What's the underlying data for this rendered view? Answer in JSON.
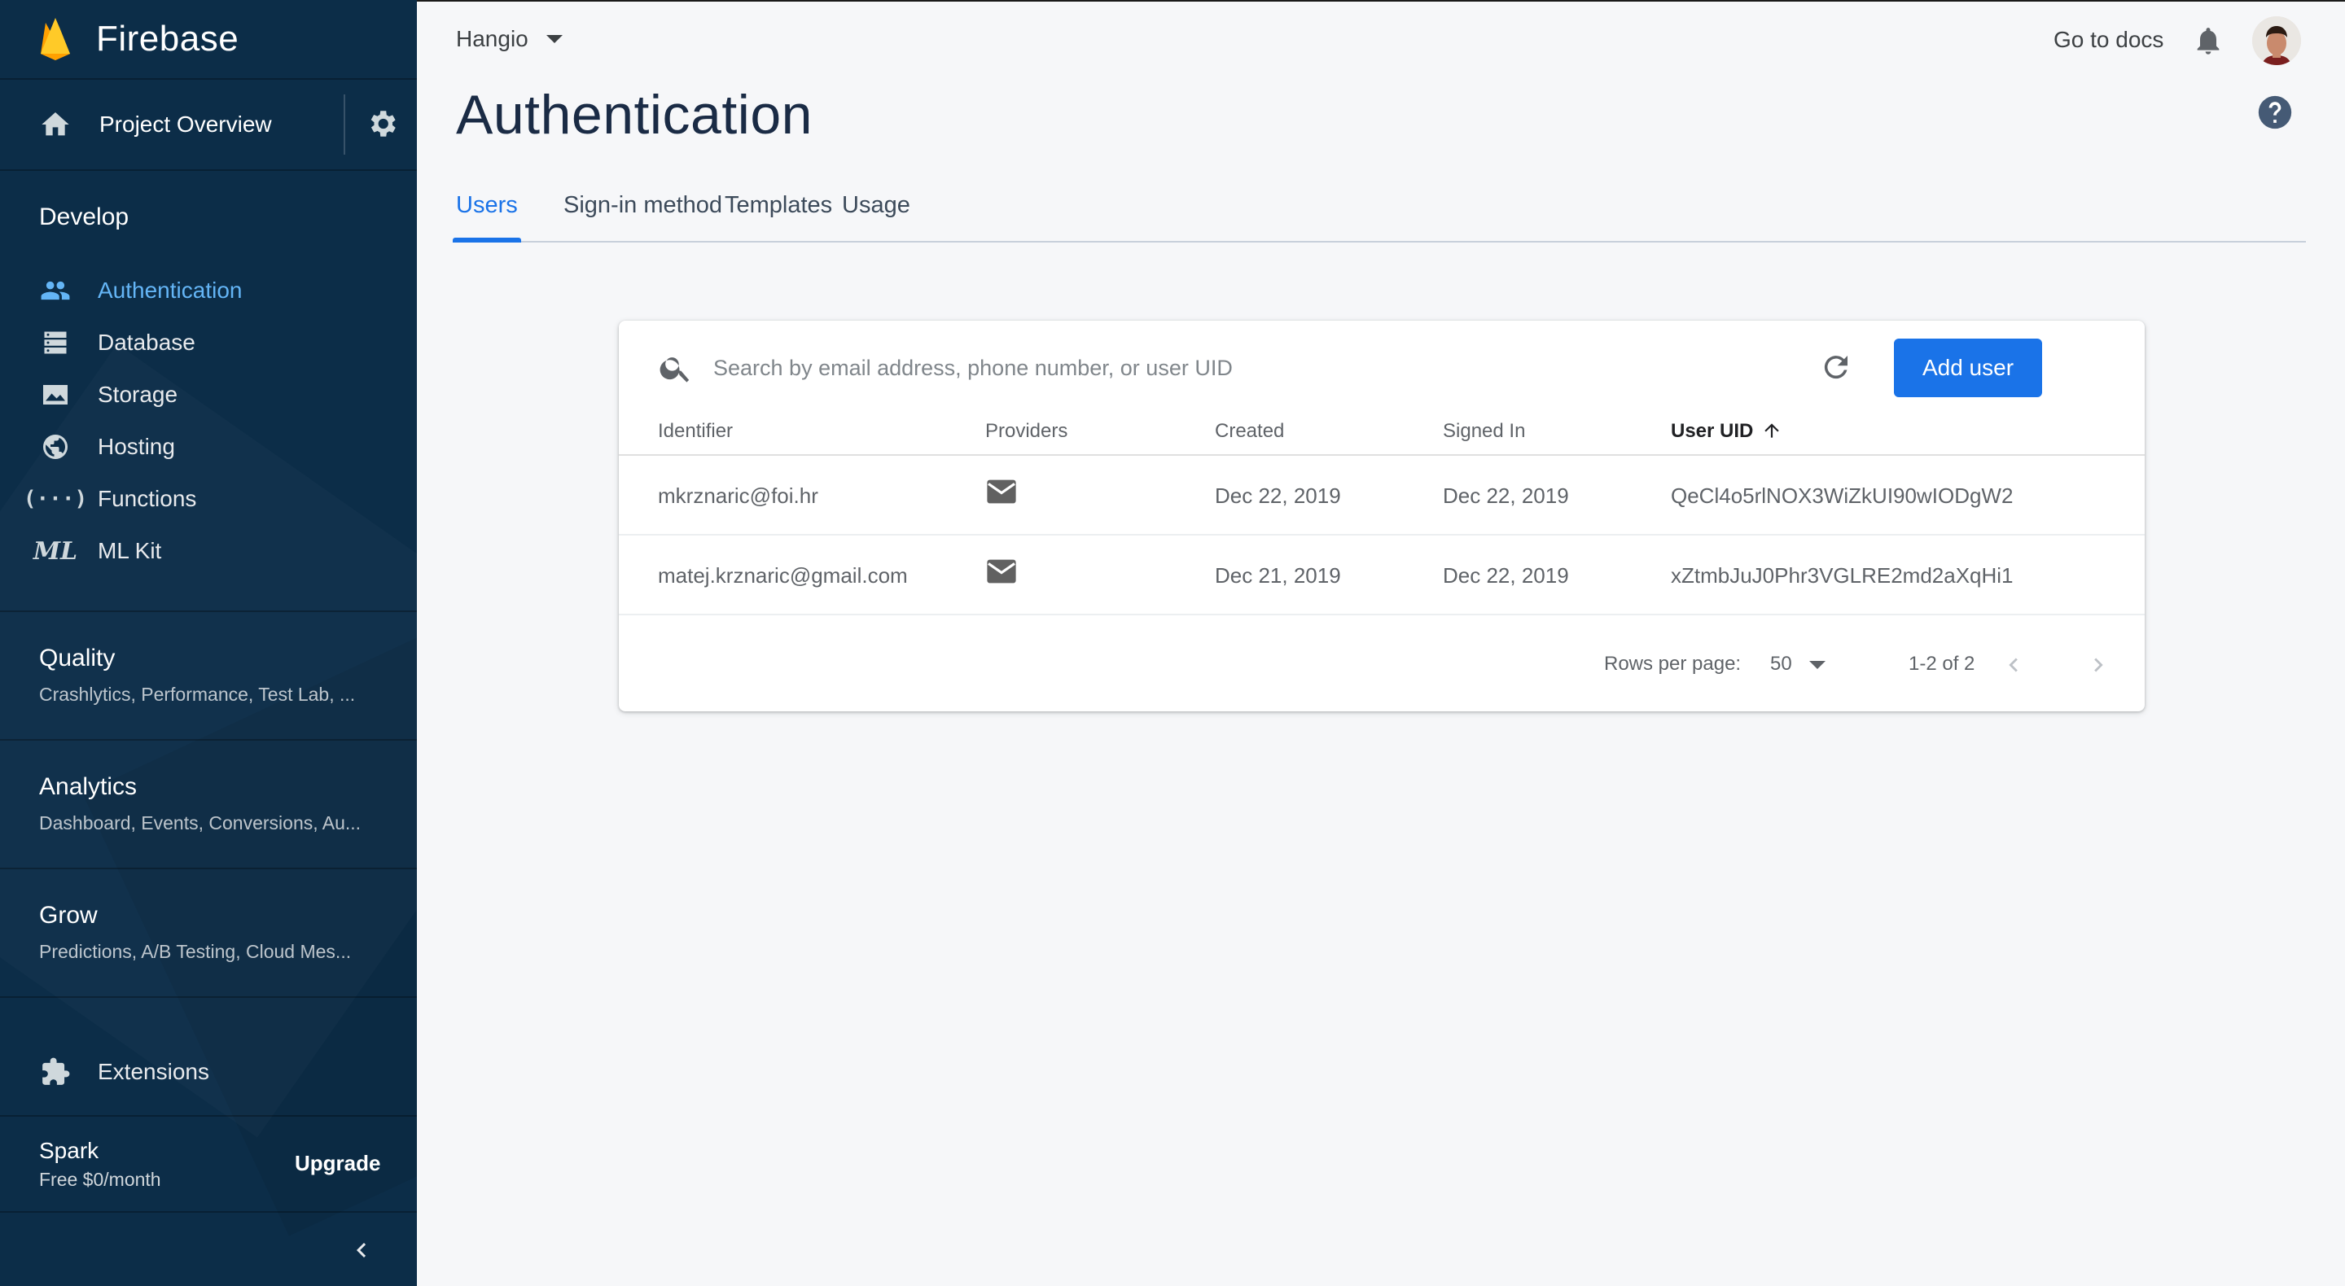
{
  "brand": {
    "name": "Firebase"
  },
  "overview": {
    "label": "Project Overview"
  },
  "develop": {
    "title": "Develop",
    "items": [
      {
        "label": "Authentication",
        "icon": "people-icon",
        "active": true
      },
      {
        "label": "Database",
        "icon": "database-icon",
        "active": false
      },
      {
        "label": "Storage",
        "icon": "storage-icon",
        "active": false
      },
      {
        "label": "Hosting",
        "icon": "globe-icon",
        "active": false
      },
      {
        "label": "Functions",
        "icon": "functions-icon",
        "active": false
      },
      {
        "label": "ML Kit",
        "icon": "mlkit-icon",
        "active": false
      }
    ]
  },
  "categories": [
    {
      "title": "Quality",
      "subtitle": "Crashlytics, Performance, Test Lab, ..."
    },
    {
      "title": "Analytics",
      "subtitle": "Dashboard, Events, Conversions, Au..."
    },
    {
      "title": "Grow",
      "subtitle": "Predictions, A/B Testing, Cloud Mes..."
    }
  ],
  "extensions": {
    "label": "Extensions"
  },
  "plan": {
    "name": "Spark",
    "price": "Free $0/month",
    "upgrade": "Upgrade"
  },
  "header": {
    "project": "Hangio",
    "docs": "Go to docs"
  },
  "page": {
    "title": "Authentication"
  },
  "tabs": [
    {
      "label": "Users",
      "active": true
    },
    {
      "label": "Sign-in method",
      "active": false
    },
    {
      "label": "Templates",
      "active": false
    },
    {
      "label": "Usage",
      "active": false
    }
  ],
  "card": {
    "search_placeholder": "Search by email address, phone number, or user UID",
    "add_user": "Add user",
    "columns": [
      "Identifier",
      "Providers",
      "Created",
      "Signed In",
      "User UID"
    ],
    "sorted_column": "User UID",
    "rows": [
      {
        "identifier": "mkrznaric@foi.hr",
        "provider": "email-icon",
        "created": "Dec 22, 2019",
        "signed_in": "Dec 22, 2019",
        "uid": "QeCl4o5rlNOX3WiZkUI90wIODgW2"
      },
      {
        "identifier": "matej.krznaric@gmail.com",
        "provider": "email-icon",
        "created": "Dec 21, 2019",
        "signed_in": "Dec 22, 2019",
        "uid": "xZtmbJuJ0Phr3VGLRE2md2aXqHi1"
      }
    ],
    "footer": {
      "rows_per_page_label": "Rows per page:",
      "rows_per_page": "50",
      "range": "1-2 of 2"
    }
  },
  "colors": {
    "sidebar_bg": "#0c2d48",
    "accent": "#1a73e8",
    "active_nav": "#64b5f6",
    "title": "#1a2b45"
  }
}
